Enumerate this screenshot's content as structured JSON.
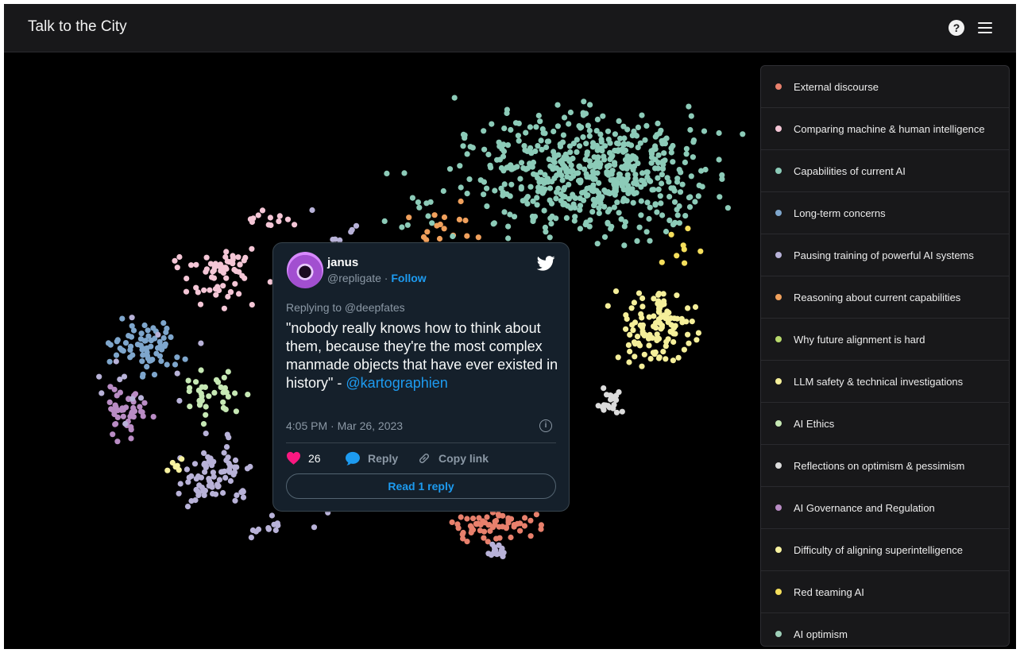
{
  "app": {
    "title": "Talk to the City"
  },
  "icons": {
    "help": "help-circle-icon",
    "menu": "hamburger-menu-icon"
  },
  "colors": {
    "background": "#000000",
    "topbar": "#18181a",
    "panel": "#18181a",
    "tweet_bg": "#15202b",
    "twitter_blue": "#1d9bf0",
    "heart": "#f91880"
  },
  "legend": [
    {
      "label": "External discourse",
      "color": "#e8806c"
    },
    {
      "label": "Comparing machine & human intelligence",
      "color": "#f4c6d6"
    },
    {
      "label": "Capabilities of current AI",
      "color": "#8ccbb8"
    },
    {
      "label": "Long-term concerns",
      "color": "#7ea6cc"
    },
    {
      "label": "Pausing training of powerful AI systems",
      "color": "#b8b2d8"
    },
    {
      "label": "Reasoning about current capabilities",
      "color": "#f0a05c"
    },
    {
      "label": "Why future alignment is hard",
      "color": "#b8d96c"
    },
    {
      "label": "LLM safety & technical investigations",
      "color": "#f5ef9a"
    },
    {
      "label": "AI Ethics",
      "color": "#c6e8b4"
    },
    {
      "label": "Reflections on optimism & pessimism",
      "color": "#dcdcdc"
    },
    {
      "label": "AI Governance and Regulation",
      "color": "#b98cc4"
    },
    {
      "label": "Difficulty of aligning superintelligence",
      "color": "#f7f2a0"
    },
    {
      "label": "Red teaming AI",
      "color": "#f5df5c"
    },
    {
      "label": "AI optimism",
      "color": "#9ecfb8"
    }
  ],
  "tweet": {
    "name": "janus",
    "handle": "@repligate",
    "separator": " · ",
    "follow_label": "Follow",
    "replying_to": "Replying to @deepfates",
    "text": "\"nobody really knows how to think about them, because they're the most complex manmade objects that have ever existed in history\" - ",
    "mention": "@kartographien",
    "time": "4:05 PM · Mar 26, 2023",
    "likes": "26",
    "reply_label": "Reply",
    "copy_link_label": "Copy link",
    "read_replies_label": "Read 1 reply"
  }
}
